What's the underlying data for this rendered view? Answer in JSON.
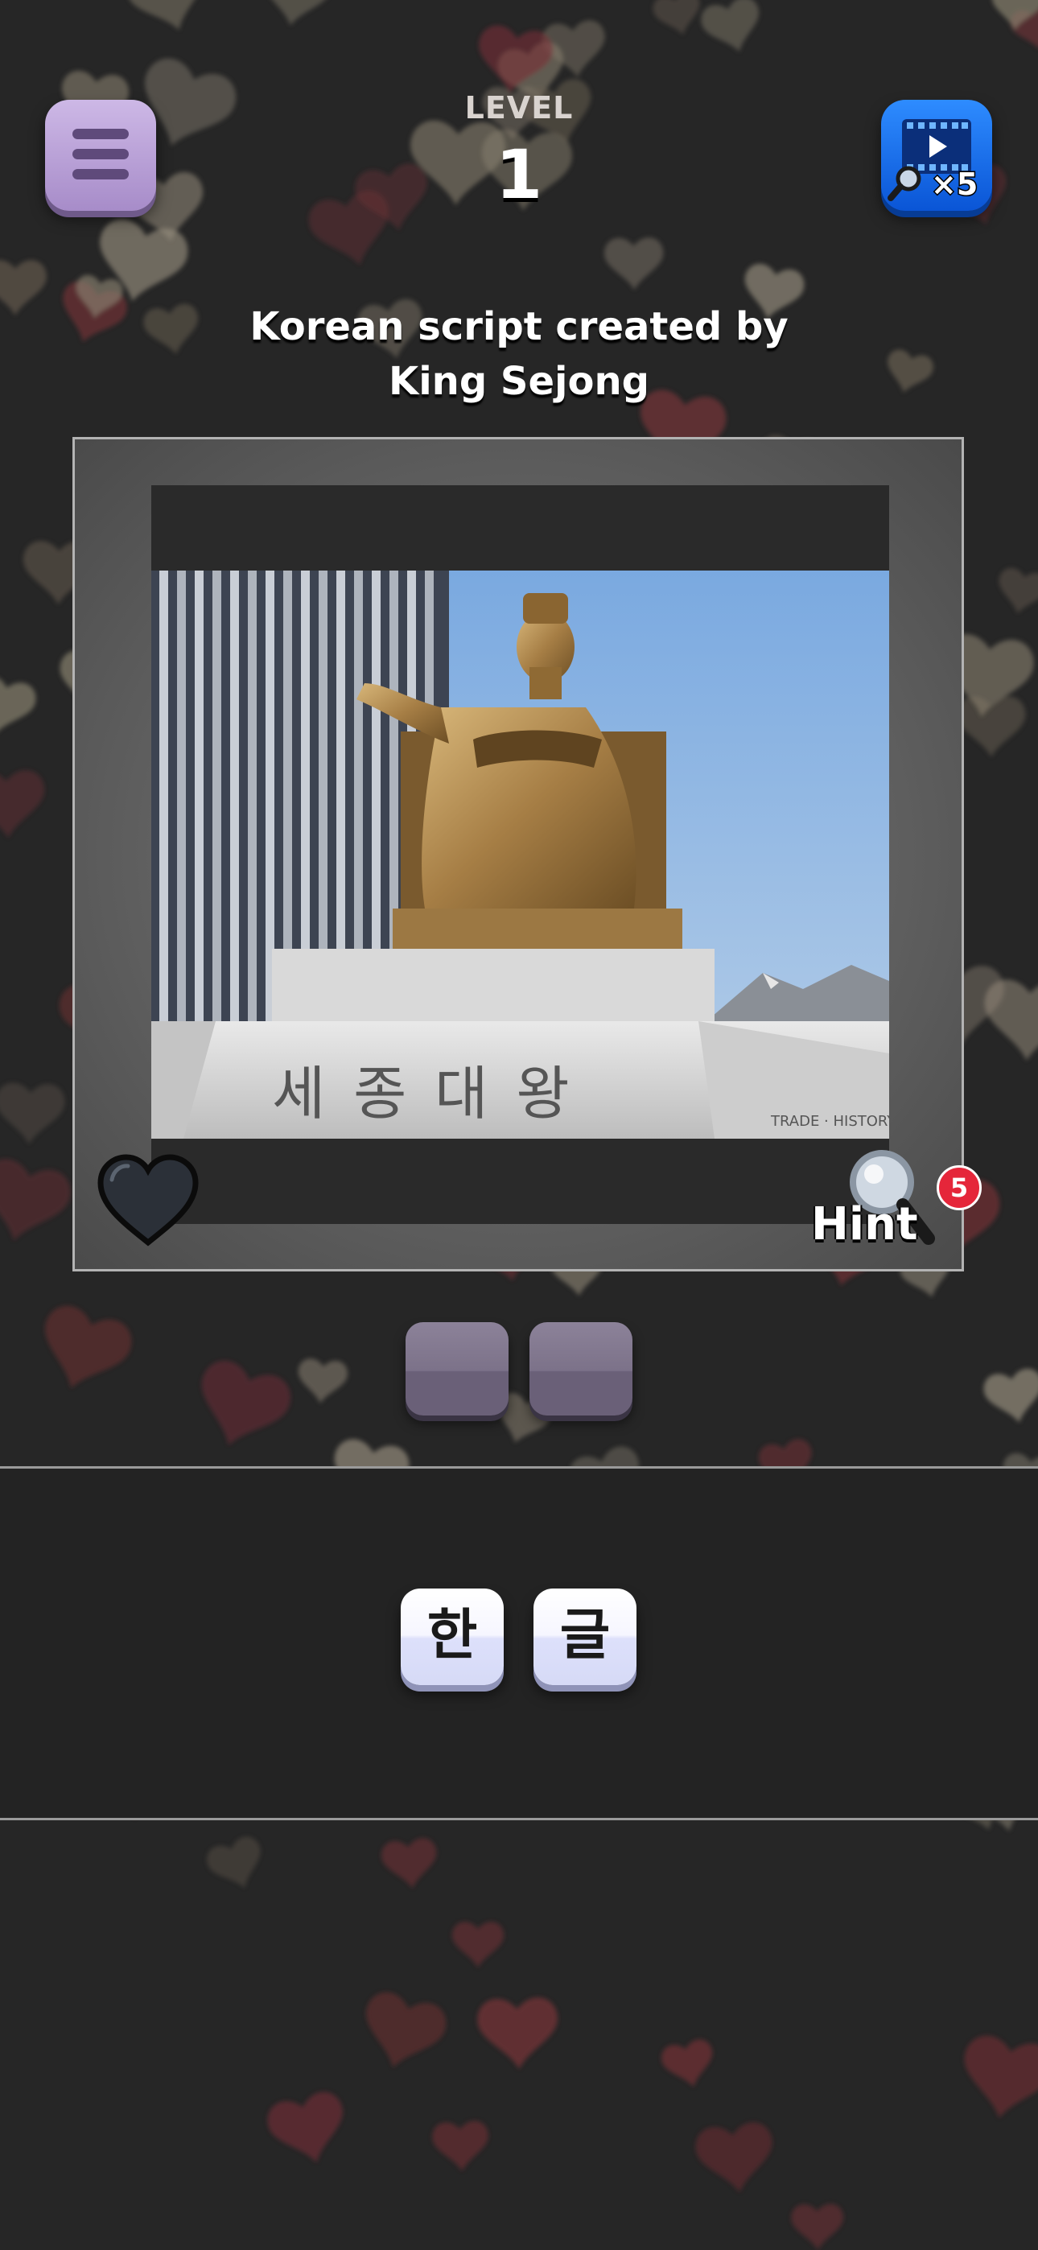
{
  "header": {
    "level_label": "LEVEL",
    "level_number": "1",
    "menu_icon": "hamburger-menu-icon",
    "video_hint_icon": "video-magnifier-icon",
    "video_hint_multiplier": "×5"
  },
  "clue": "Korean script created by King Sejong",
  "puzzle": {
    "image_subject": "King Sejong statue",
    "inscription": "세 종 대 왕",
    "favorite_icon": "heart-icon",
    "hint_icon": "magnifying-glass-icon",
    "hint_label": "Hint",
    "hint_count": "5"
  },
  "answer_slots": [
    "",
    ""
  ],
  "letter_tiles": [
    "한",
    "글"
  ],
  "colors": {
    "background": "#262626",
    "menu_button": "#b49cd4",
    "video_button": "#1473f0",
    "hint_badge": "#e5263a",
    "slot": "#7c7289",
    "tile": "#eef0ff"
  }
}
